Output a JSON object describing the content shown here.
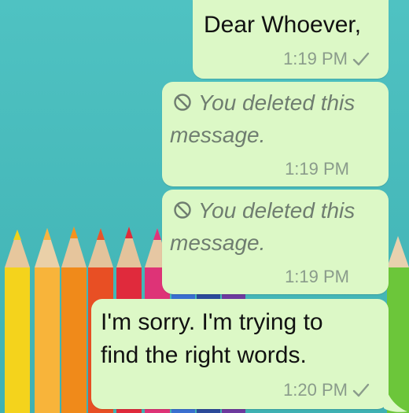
{
  "chat": {
    "messages": [
      {
        "text": "Dear Whoever,",
        "time": "1:19 PM",
        "delivered": true
      },
      {
        "deleted_text_line1": "You deleted this",
        "deleted_text_line2": "message.",
        "time": "1:19 PM",
        "deleted": true
      },
      {
        "deleted_text_line1": "You deleted this",
        "deleted_text_line2": "message.",
        "time": "1:19 PM",
        "deleted": true
      },
      {
        "text_line1": "I'm sorry. I'm trying to",
        "text_line2": "find the right words.",
        "time": "1:20 PM",
        "delivered": true
      }
    ],
    "icons": {
      "delivered": "check-icon",
      "deleted": "ban-icon"
    },
    "colors": {
      "bubble": "#dcf8c6",
      "wallpaper": "#4bbfbf",
      "timestamp": "#8a9b8b",
      "deleted_text": "#6f7d70"
    }
  }
}
